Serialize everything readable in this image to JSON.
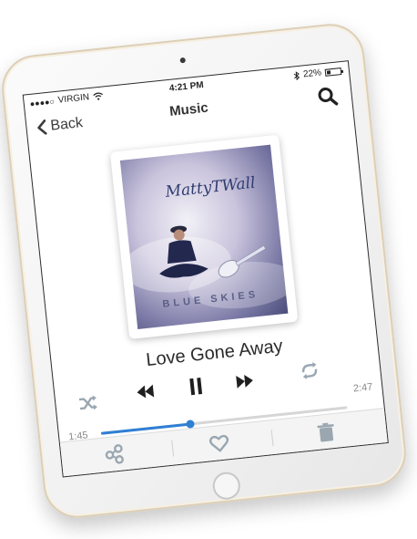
{
  "status_bar": {
    "carrier": "VIRGIN",
    "time": "4:21 PM",
    "battery": "22%"
  },
  "nav": {
    "back_label": "Back",
    "title": "Music"
  },
  "album": {
    "artist_logo": "MattyTWall",
    "title_on_cover": "BLUE SKIES"
  },
  "player": {
    "song_title": "Love Gone Away",
    "elapsed": "1:45",
    "total": "2:47",
    "progress": 0.36
  },
  "icons": {
    "shuffle": "shuffle-icon",
    "rewind": "rewind-icon",
    "pause": "pause-icon",
    "forward": "fast-forward-icon",
    "repeat": "repeat-icon",
    "share": "share-icon",
    "like": "heart-icon",
    "delete": "trash-icon",
    "search": "search-icon"
  },
  "colors": {
    "accent": "#2f7fd4",
    "icon_muted": "#9aa7b1"
  }
}
